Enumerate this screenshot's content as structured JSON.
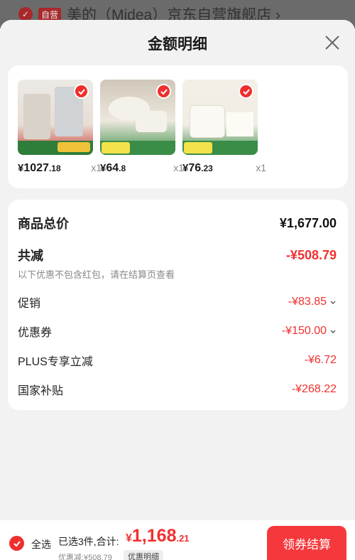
{
  "background_store": {
    "badge": "自营",
    "name": "美的（Midea）京东自营旗舰店 ›"
  },
  "sheet": {
    "title": "金额明细"
  },
  "products": [
    {
      "price_symbol": "¥",
      "price_int": "1027",
      "price_dec": ".18",
      "qty": "x1",
      "thumb_colors": [
        "#e8e0d8",
        "#c0392b"
      ]
    },
    {
      "price_symbol": "¥",
      "price_int": "64",
      "price_dec": ".8",
      "qty": "x1",
      "thumb_colors": [
        "#e9e6dc",
        "#3a9a4a"
      ]
    },
    {
      "price_symbol": "¥",
      "price_int": "76",
      "price_dec": ".23",
      "qty": "x1",
      "thumb_colors": [
        "#f2ede4",
        "#3a9a4a"
      ]
    }
  ],
  "summary": {
    "goods_total_label": "商品总价",
    "goods_total_value": "¥1,677.00",
    "discount_label": "共减",
    "discount_value": "-¥508.79",
    "note": "以下优惠不包含红包，请在结算页查看",
    "items": [
      {
        "label": "促销",
        "value": "-¥83.85",
        "has_chevron": true
      },
      {
        "label": "优惠券",
        "value": "-¥150.00",
        "has_chevron": true
      },
      {
        "label": "PLUS专享立减",
        "value": "-¥6.72",
        "has_chevron": false
      },
      {
        "label": "国家补贴",
        "value": "-¥268.22",
        "has_chevron": false
      }
    ]
  },
  "bottom_bar": {
    "select_all": "全选",
    "selected_text": "已选3件,合计:",
    "total_symbol": "¥",
    "total_int": "1,168",
    "total_dec": ".21",
    "saved_text": "优惠减:¥508.79",
    "detail_chip": "优惠明细",
    "checkout_label": "领券结算"
  },
  "colors": {
    "accent": "#f23030",
    "button": "#f5383b"
  }
}
